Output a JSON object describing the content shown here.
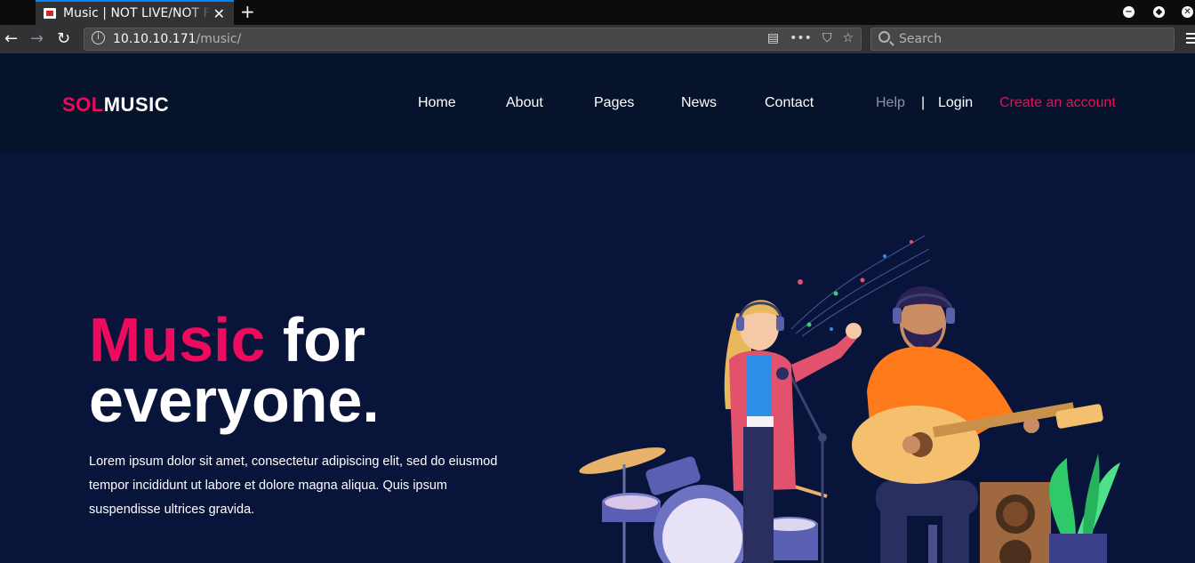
{
  "browser": {
    "tab_title": "Music | NOT LIVE/NOT FOR PRODUCTION",
    "url_host": "10.10.10.171",
    "url_path": "/music/",
    "search_placeholder": "Search"
  },
  "site": {
    "logo_sol": "SOL",
    "logo_music": "MUSIC",
    "nav": {
      "home": "Home",
      "about": "About",
      "pages": "Pages",
      "news": "News",
      "contact": "Contact",
      "help": "Help",
      "separator": "|",
      "login": "Login",
      "create_account": "Create an account"
    },
    "hero": {
      "title_accent": "Music",
      "title_rest_1": " for",
      "title_rest_2": "everyone.",
      "text": "Lorem ipsum dolor sit amet, consectetur adipiscing elit, sed do eiusmod tempor incididunt ut labore et dolore magna aliqua. Quis ipsum suspendisse ultrices gravida."
    },
    "colors": {
      "accent": "#ec0b5c",
      "header_bg": "#06132b",
      "hero_bg": "#08143a"
    }
  }
}
